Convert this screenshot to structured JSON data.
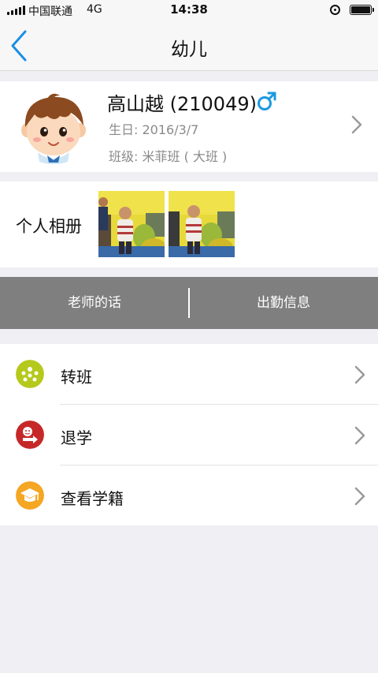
{
  "status_bar": {
    "carrier": "中国联通",
    "network": "4G",
    "time": "14:38"
  },
  "nav": {
    "title": "幼儿",
    "back_icon": "chevron-left-icon"
  },
  "child": {
    "name": "高山越 (210049)",
    "gender_icon": "male-icon",
    "birthday": "生日: 2016/3/7",
    "class": "班级: 米菲班 ( 大班 )"
  },
  "album": {
    "label": "个人相册",
    "photo_count": 2
  },
  "tabs": [
    {
      "label": "老师的话"
    },
    {
      "label": "出勤信息"
    }
  ],
  "menu": [
    {
      "label": "转班",
      "icon": "transfer-class-icon",
      "color": "#b5c91d"
    },
    {
      "label": "退学",
      "icon": "withdraw-icon",
      "color": "#c62828"
    },
    {
      "label": "查看学籍",
      "icon": "graduation-cap-icon",
      "color": "#f5a623"
    }
  ],
  "colors": {
    "accent": "#1a8fe3",
    "tab_bar": "#7f7f7f",
    "background": "#efeff4"
  }
}
